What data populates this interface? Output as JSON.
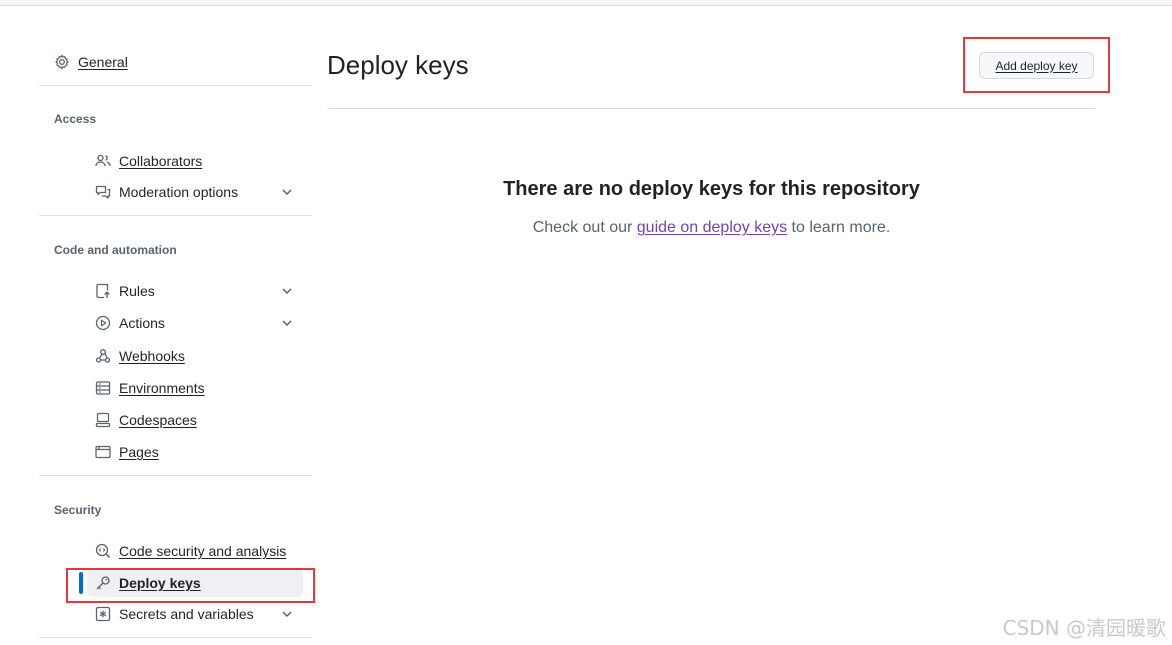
{
  "sidebar": {
    "general": {
      "label": "General",
      "icon": "gear-icon"
    },
    "sections": {
      "access": {
        "title": "Access",
        "items": [
          {
            "label": "Collaborators",
            "icon": "people-icon"
          },
          {
            "label": "Moderation options",
            "icon": "comment-discussion-icon",
            "expandable": true
          }
        ]
      },
      "code_automation": {
        "title": "Code and automation",
        "items": [
          {
            "label": "Rules",
            "icon": "repo-push-icon",
            "expandable": true
          },
          {
            "label": "Actions",
            "icon": "play-icon",
            "expandable": true
          },
          {
            "label": "Webhooks",
            "icon": "webhook-icon"
          },
          {
            "label": "Environments",
            "icon": "server-icon"
          },
          {
            "label": "Codespaces",
            "icon": "codespaces-icon"
          },
          {
            "label": "Pages",
            "icon": "browser-icon"
          }
        ]
      },
      "security": {
        "title": "Security",
        "items": [
          {
            "label": "Code security and analysis",
            "icon": "codescan-icon"
          },
          {
            "label": "Deploy keys",
            "icon": "key-icon",
            "active": true
          },
          {
            "label": "Secrets and variables",
            "icon": "key-asterisk-icon",
            "expandable": true
          }
        ]
      }
    }
  },
  "main": {
    "title": "Deploy keys",
    "add_button": "Add deploy key",
    "blank_title": "There are no deploy keys for this repository",
    "blank_prefix": "Check out our ",
    "blank_link": "guide on deploy keys",
    "blank_suffix": " to learn more."
  },
  "watermark": "CSDN @清园暖歌",
  "colors": {
    "accent": "#0969da",
    "link_visited": "#6f42c1",
    "annotation": "#e5383b"
  }
}
